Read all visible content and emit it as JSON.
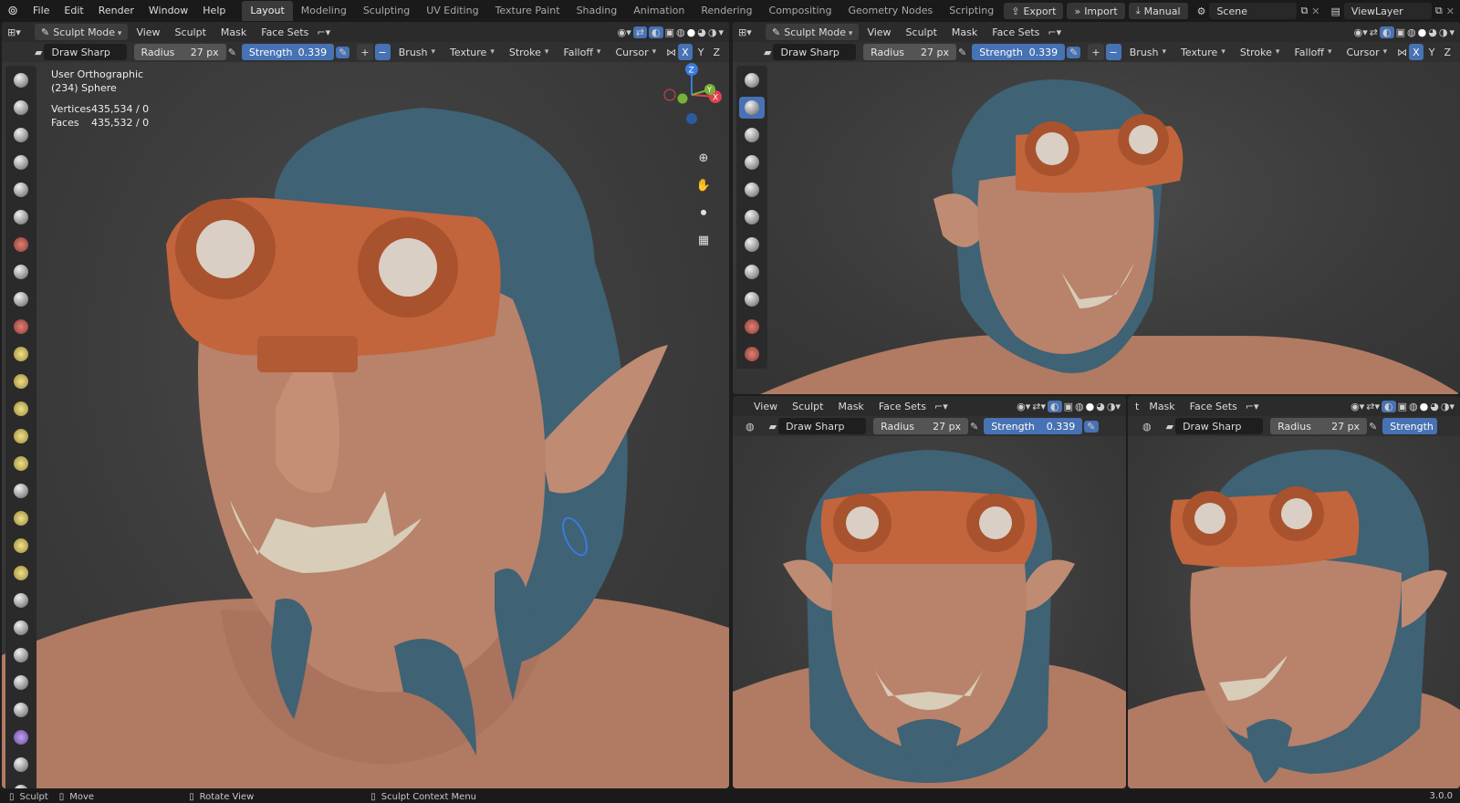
{
  "topbar": {
    "menus": [
      "File",
      "Edit",
      "Render",
      "Window",
      "Help"
    ],
    "workspaces": [
      "Layout",
      "Modeling",
      "Sculpting",
      "UV Editing",
      "Texture Paint",
      "Shading",
      "Animation",
      "Rendering",
      "Compositing",
      "Geometry Nodes",
      "Scripting"
    ],
    "active_workspace": "Layout",
    "add": "+",
    "export_label": "Export",
    "import_label": "Import",
    "manual_label": "Manual",
    "scene_value": "Scene",
    "viewlayer_value": "ViewLayer"
  },
  "main": {
    "mode": "Sculpt Mode",
    "menus": [
      "View",
      "Sculpt",
      "Mask",
      "Face Sets"
    ],
    "brush_name": "Draw Sharp",
    "radius_label": "Radius",
    "radius_value": "27 px",
    "strength_label": "Strength",
    "strength_value": "0.339",
    "plus": "+",
    "minus": "−",
    "dropdowns": [
      "Brush",
      "Texture",
      "Stroke",
      "Falloff",
      "Cursor"
    ],
    "axes": [
      "X",
      "Y",
      "Z"
    ],
    "view_name": "User Orthographic",
    "object_name": "(234) Sphere",
    "vertices_label": "Vertices",
    "vertices_value": "435,534 / 0",
    "faces_label": "Faces",
    "faces_value": "435,532 / 0"
  },
  "top_right": {
    "mode": "Sculpt Mode",
    "menus": [
      "View",
      "Sculpt",
      "Mask",
      "Face Sets"
    ],
    "brush_name": "Draw Sharp",
    "radius_label": "Radius",
    "radius_value": "27 px",
    "strength_label": "Strength",
    "strength_value": "0.339",
    "dropdowns": [
      "Brush",
      "Texture",
      "Stroke",
      "Falloff",
      "Cursor"
    ],
    "axes": [
      "X",
      "Y",
      "Z"
    ]
  },
  "bottom_mid": {
    "menus": [
      "View",
      "Sculpt",
      "Mask",
      "Face Sets"
    ],
    "brush_name": "Draw Sharp",
    "radius_label": "Radius",
    "radius_value": "27 px",
    "strength_label": "Strength",
    "strength_value": "0.339"
  },
  "bottom_right": {
    "menus": [
      "t",
      "Mask",
      "Face Sets"
    ],
    "brush_name": "Draw Sharp",
    "radius_label": "Radius",
    "radius_value": "27 px",
    "strength_label": "Strength"
  },
  "gizmo": {
    "z": "Z",
    "y": "Y",
    "x": "X"
  },
  "statusbar": {
    "sculpt": "Sculpt",
    "move": "Move",
    "rotate": "Rotate View",
    "context": "Sculpt Context Menu",
    "version": "3.0.0"
  },
  "colors": {
    "accent": "#4772b3",
    "skin": "#b9826a",
    "hair": "#3f6275",
    "goggles": "#c2653c",
    "lens": "#d9cfc4"
  }
}
